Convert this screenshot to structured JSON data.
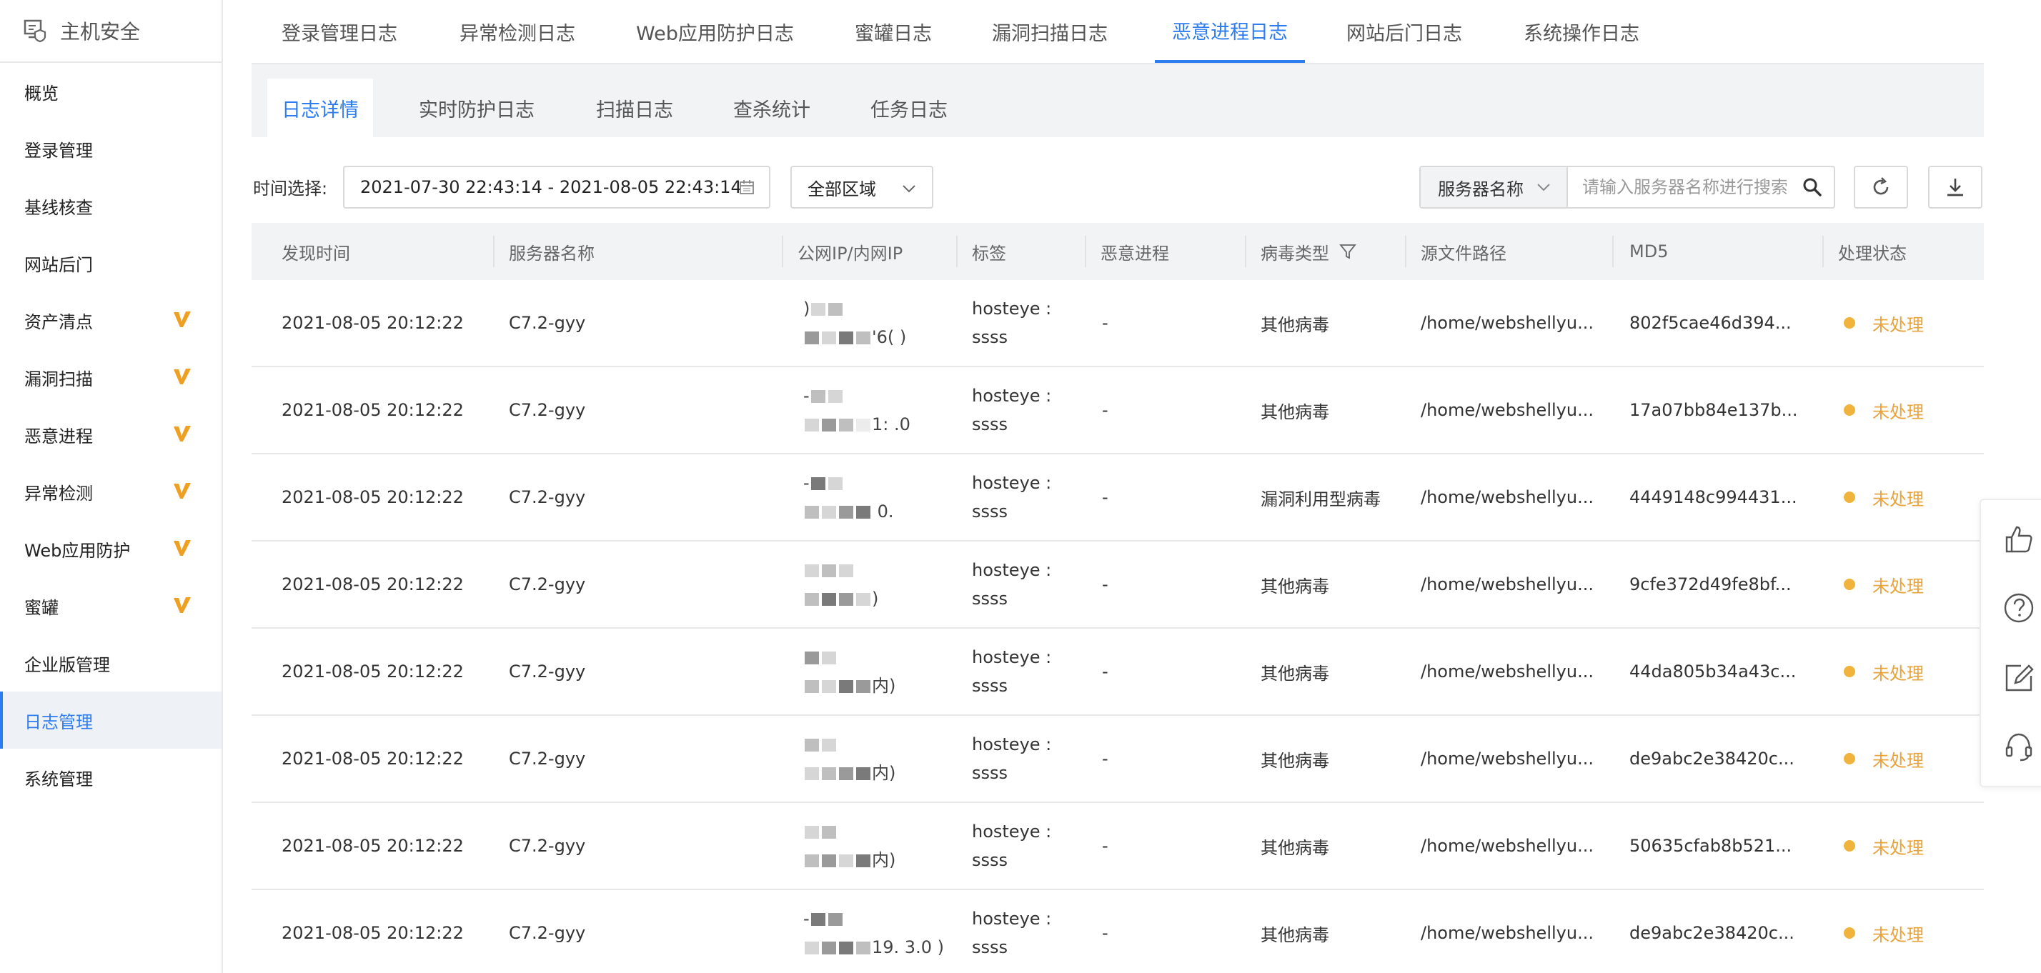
{
  "sidebar": {
    "title": "主机安全",
    "items": [
      {
        "label": "概览",
        "badge": false
      },
      {
        "label": "登录管理",
        "badge": false
      },
      {
        "label": "基线核查",
        "badge": false
      },
      {
        "label": "网站后门",
        "badge": false
      },
      {
        "label": "资产清点",
        "badge": true
      },
      {
        "label": "漏洞扫描",
        "badge": true
      },
      {
        "label": "恶意进程",
        "badge": true
      },
      {
        "label": "异常检测",
        "badge": true
      },
      {
        "label": "Web应用防护",
        "badge": true
      },
      {
        "label": "蜜罐",
        "badge": true
      },
      {
        "label": "企业版管理",
        "badge": false
      },
      {
        "label": "日志管理",
        "badge": false,
        "active": true
      },
      {
        "label": "系统管理",
        "badge": false
      }
    ]
  },
  "top_tabs": [
    {
      "label": "登录管理日志"
    },
    {
      "label": "异常检测日志"
    },
    {
      "label": "Web应用防护日志"
    },
    {
      "label": "蜜罐日志"
    },
    {
      "label": "漏洞扫描日志"
    },
    {
      "label": "恶意进程日志",
      "active": true
    },
    {
      "label": "网站后门日志"
    },
    {
      "label": "系统操作日志"
    }
  ],
  "sub_tabs": [
    {
      "label": "日志详情",
      "active": true
    },
    {
      "label": "实时防护日志"
    },
    {
      "label": "扫描日志"
    },
    {
      "label": "查杀统计"
    },
    {
      "label": "任务日志"
    }
  ],
  "filter": {
    "time_label": "时间选择:",
    "date_range": "2021-07-30 22:43:14 - 2021-08-05 22:43:14",
    "region": "全部区域",
    "search_type": "服务器名称",
    "search_placeholder": "请输入服务器名称进行搜索"
  },
  "table": {
    "columns": [
      "发现时间",
      "服务器名称",
      "公网IP/内网IP",
      "标签",
      "恶意进程",
      "病毒类型",
      "源文件路径",
      "MD5",
      "处理状态"
    ],
    "rows": [
      {
        "time": "2021-08-05 20:12:22",
        "server": "C7.2-gyy",
        "ip1": ")",
        "ip2": "'6(  )",
        "tag1": "hosteye :",
        "tag2": "ssss",
        "process": "-",
        "virus": "其他病毒",
        "path": "/home/webshellyu...",
        "md5": "802f5cae46d394...",
        "status": "未处理"
      },
      {
        "time": "2021-08-05 20:12:22",
        "server": "C7.2-gyy",
        "ip1": "-",
        "ip2": "1:   .0",
        "tag1": "hosteye :",
        "tag2": "ssss",
        "process": "-",
        "virus": "其他病毒",
        "path": "/home/webshellyu...",
        "md5": "17a07bb84e137b...",
        "status": "未处理"
      },
      {
        "time": "2021-08-05 20:12:22",
        "server": "C7.2-gyy",
        "ip1": "-",
        "ip2": "    0.",
        "tag1": "hosteye :",
        "tag2": "ssss",
        "process": "-",
        "virus": "漏洞利用型病毒",
        "path": "/home/webshellyu...",
        "md5": "4449148c994431...",
        "status": "未处理"
      },
      {
        "time": "2021-08-05 20:12:22",
        "server": "C7.2-gyy",
        "ip1": "",
        "ip2": ")",
        "tag1": "hosteye :",
        "tag2": "ssss",
        "process": "-",
        "virus": "其他病毒",
        "path": "/home/webshellyu...",
        "md5": "9cfe372d49fe8bf...",
        "status": "未处理"
      },
      {
        "time": "2021-08-05 20:12:22",
        "server": "C7.2-gyy",
        "ip1": "",
        "ip2": "内)",
        "tag1": "hosteye :",
        "tag2": "ssss",
        "process": "-",
        "virus": "其他病毒",
        "path": "/home/webshellyu...",
        "md5": "44da805b34a43c...",
        "status": "未处理"
      },
      {
        "time": "2021-08-05 20:12:22",
        "server": "C7.2-gyy",
        "ip1": "",
        "ip2": "内)",
        "tag1": "hosteye :",
        "tag2": "ssss",
        "process": "-",
        "virus": "其他病毒",
        "path": "/home/webshellyu...",
        "md5": "de9abc2e38420c...",
        "status": "未处理"
      },
      {
        "time": "2021-08-05 20:12:22",
        "server": "C7.2-gyy",
        "ip1": "",
        "ip2": "内)",
        "tag1": "hosteye :",
        "tag2": "ssss",
        "process": "-",
        "virus": "其他病毒",
        "path": "/home/webshellyu...",
        "md5": "50635cfab8b521...",
        "status": "未处理"
      },
      {
        "time": "2021-08-05 20:12:22",
        "server": "C7.2-gyy",
        "ip1": "-",
        "ip2": "19.  3.0  )",
        "tag1": "hosteye :",
        "tag2": "ssss",
        "process": "-",
        "virus": "其他病毒",
        "path": "/home/webshellyu...",
        "md5": "de9abc2e38420c...",
        "status": "未处理"
      }
    ]
  },
  "colors": {
    "accent": "#2d7cf0",
    "badge": "#f0a020",
    "status_pending": "#e8a33d",
    "header_bg": "#f2f3f5"
  },
  "icons": {
    "app": "host-security-icon",
    "badge": "v-badge-icon",
    "calendar": "calendar-icon",
    "search": "search-icon",
    "refresh": "refresh-icon",
    "download": "download-icon",
    "filter": "filter-icon",
    "float": [
      "thumbs-up-icon",
      "help-icon",
      "edit-icon",
      "headset-icon"
    ]
  }
}
